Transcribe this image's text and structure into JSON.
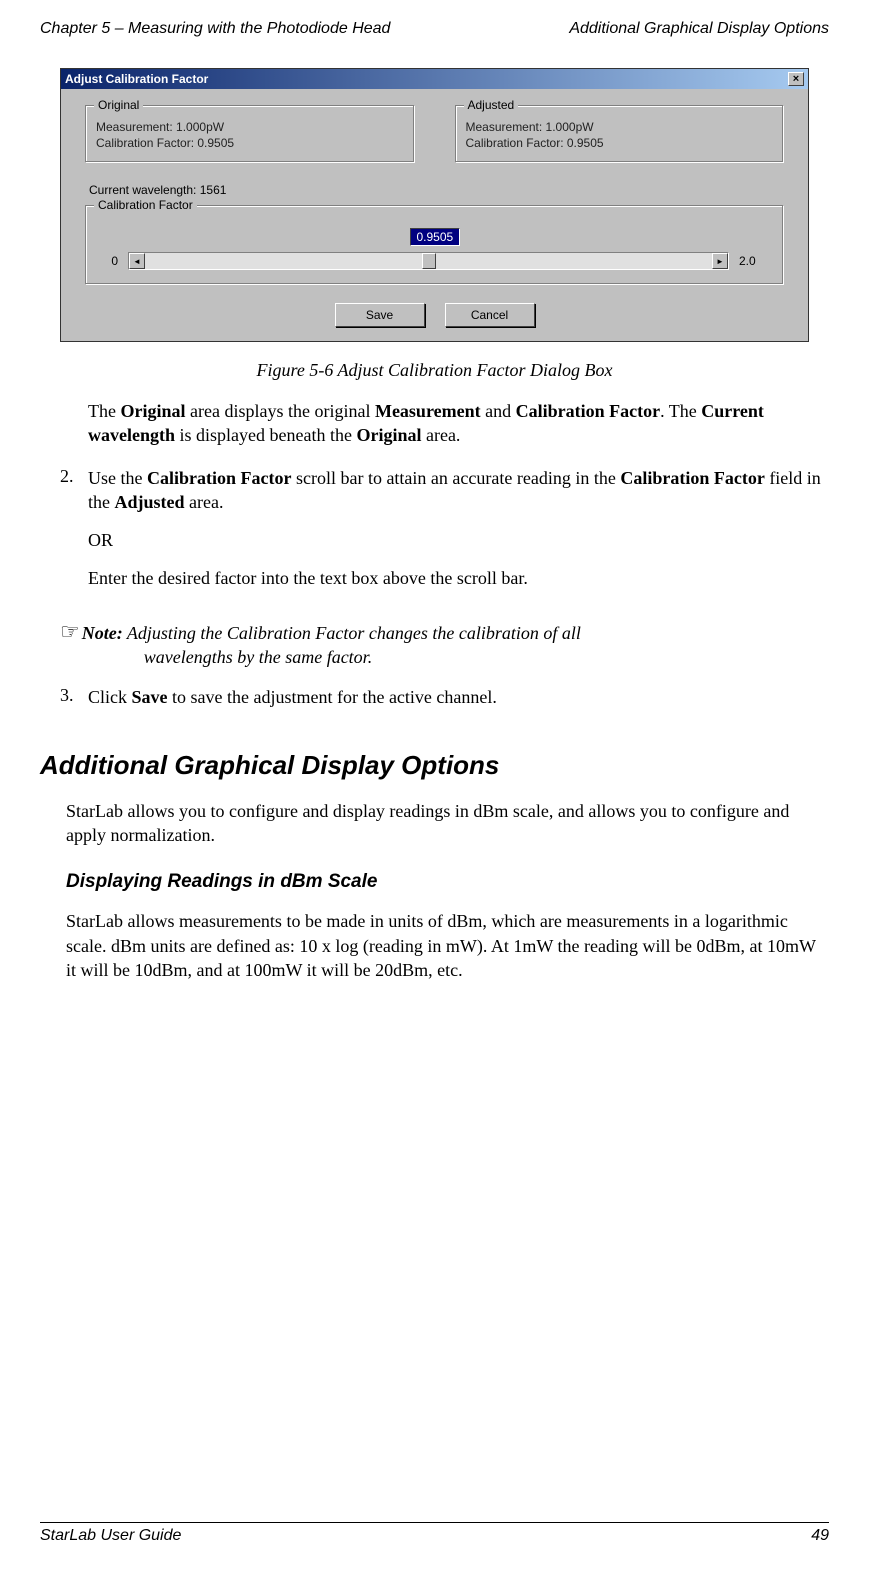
{
  "header": {
    "left": "Chapter 5 – Measuring with the Photodiode Head",
    "right": "Additional Graphical Display Options"
  },
  "dialog": {
    "title": "Adjust Calibration Factor",
    "close_glyph": "×",
    "original": {
      "legend": "Original",
      "measurement": "Measurement: 1.000pW",
      "calibration": "Calibration Factor: 0.9505"
    },
    "adjusted": {
      "legend": "Adjusted",
      "measurement": "Measurement: 1.000pW",
      "calibration": "Calibration Factor: 0.9505"
    },
    "current_wavelength": "Current wavelength: 1561",
    "calib_group": {
      "legend": "Calibration Factor",
      "input_value": "0.9505",
      "min": "0",
      "max": "2.0",
      "left_arrow": "◄",
      "right_arrow": "►"
    },
    "buttons": {
      "save": "Save",
      "cancel": "Cancel"
    }
  },
  "figure_caption": "Figure 5-6 Adjust Calibration Factor Dialog Box",
  "intro_para_parts": {
    "p1": "The ",
    "p2": "Original",
    "p3": " area displays the original ",
    "p4": "Measurement",
    "p5": " and ",
    "p6": "Calibration Factor",
    "p7": ". The ",
    "p8": "Current wavelength",
    "p9": " is displayed beneath the ",
    "p10": "Original",
    "p11": " area."
  },
  "step2": {
    "num": "2.",
    "l1a": "Use the ",
    "l1b": "Calibration Factor",
    "l1c": " scroll bar to attain an accurate reading in the ",
    "l1d": "Calibration Factor",
    "l1e": " field in the ",
    "l1f": "Adjusted",
    "l1g": " area.",
    "or": "OR",
    "l2": "Enter the desired factor into the text box above the scroll bar."
  },
  "note": {
    "label": "Note:",
    "text1": " Adjusting the Calibration Factor changes the calibration of all",
    "text2": "wavelengths by the same factor."
  },
  "step3": {
    "num": "3.",
    "a": "Click ",
    "b": "Save",
    "c": " to save the adjustment for the active channel."
  },
  "section_title": "Additional Graphical Display Options",
  "section_para": "StarLab allows you to configure and display readings in dBm scale, and allows you to configure and apply normalization.",
  "subsection_title": "Displaying Readings in dBm Scale",
  "subsection_para": "StarLab allows measurements to be made in units of dBm, which are measurements in a logarithmic scale. dBm units are defined as: 10 x log (reading in mW). At 1mW the reading will be 0dBm, at 10mW it will be 10dBm, and at 100mW it will be 20dBm, etc.",
  "footer": {
    "left": "StarLab User Guide",
    "right": "49"
  }
}
